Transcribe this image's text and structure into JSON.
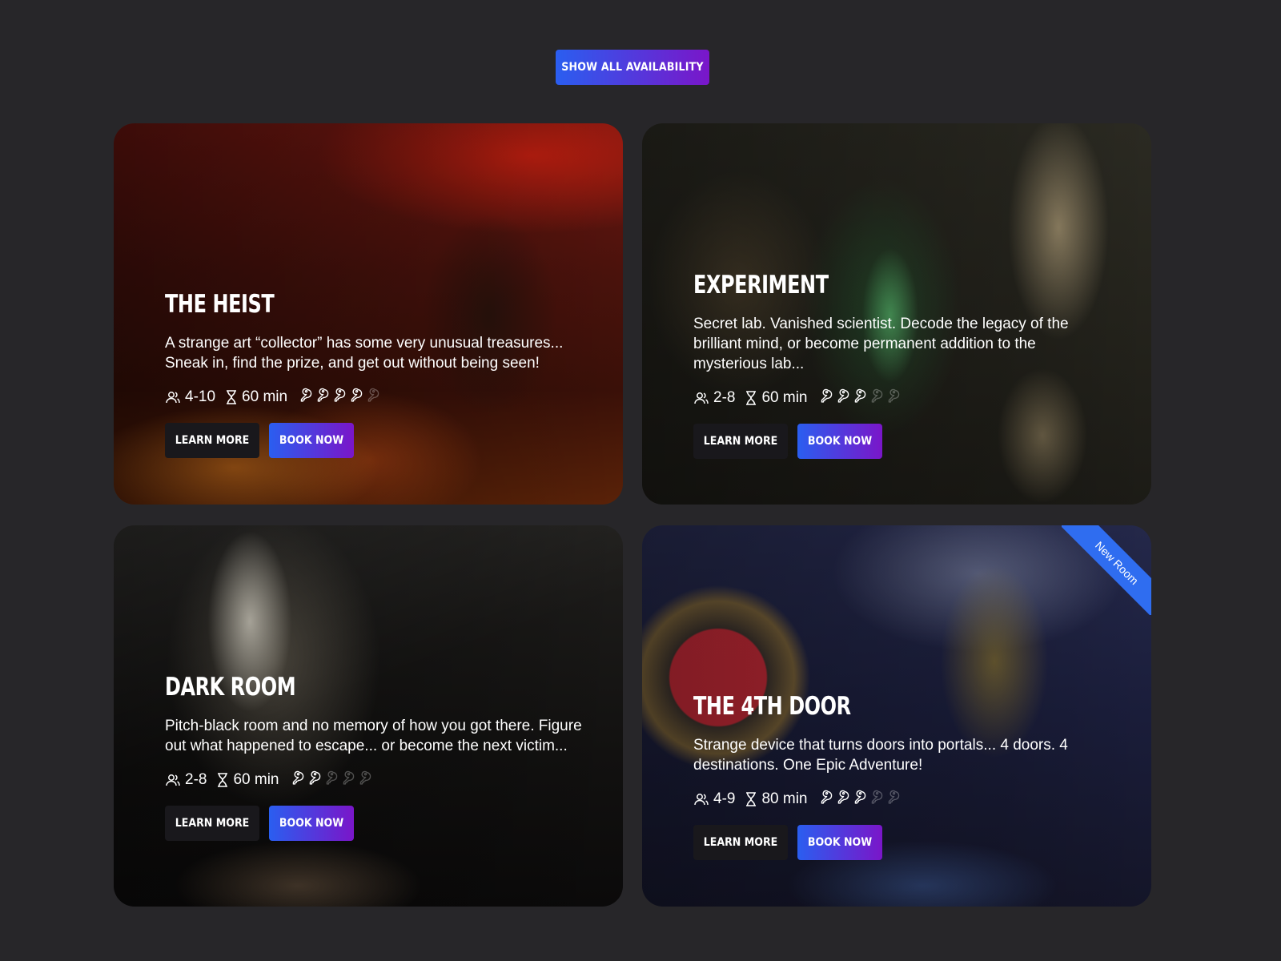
{
  "colors": {
    "page_bg": "#272629",
    "gradient_start": "#2a5ef0",
    "gradient_end": "#7a16c9",
    "learn_bg": "#19181c",
    "ribbon": "#2f6df0",
    "key_active": "#ffffff",
    "key_inactive": "rgba(255,255,255,0.28)"
  },
  "top_button": {
    "label": "Show all availability"
  },
  "labels": {
    "learn_more": "Learn more",
    "book_now": "Book now"
  },
  "rooms": [
    {
      "title": "The Heist",
      "description": "A strange art “collector” has some very unusual treasures... Sneak in, find the prize, and get out without being seen!",
      "players": "4-10",
      "duration": "60 min",
      "difficulty": 4,
      "difficulty_max": 5,
      "theme": "heist"
    },
    {
      "title": "Experiment",
      "description": "Secret lab. Vanished scientist. Decode the legacy of the brilliant mind, or become permanent addition to the mysterious lab...",
      "players": "2-8",
      "duration": "60 min",
      "difficulty": 3,
      "difficulty_max": 5,
      "theme": "lab"
    },
    {
      "title": "Dark Room",
      "description": "Pitch-black room and no memory of how you got there. Figure out what happened to escape... or become the next victim...",
      "players": "2-8",
      "duration": "60 min",
      "difficulty": 2,
      "difficulty_max": 5,
      "theme": "dark"
    },
    {
      "title": "The 4th Door",
      "description": "Strange device that turns doors into portals... 4 doors. 4 destinations. One Epic Adventure!",
      "players": "4-9",
      "duration": "80 min",
      "difficulty": 3,
      "difficulty_max": 5,
      "ribbon": "New Room",
      "theme": "door"
    }
  ]
}
